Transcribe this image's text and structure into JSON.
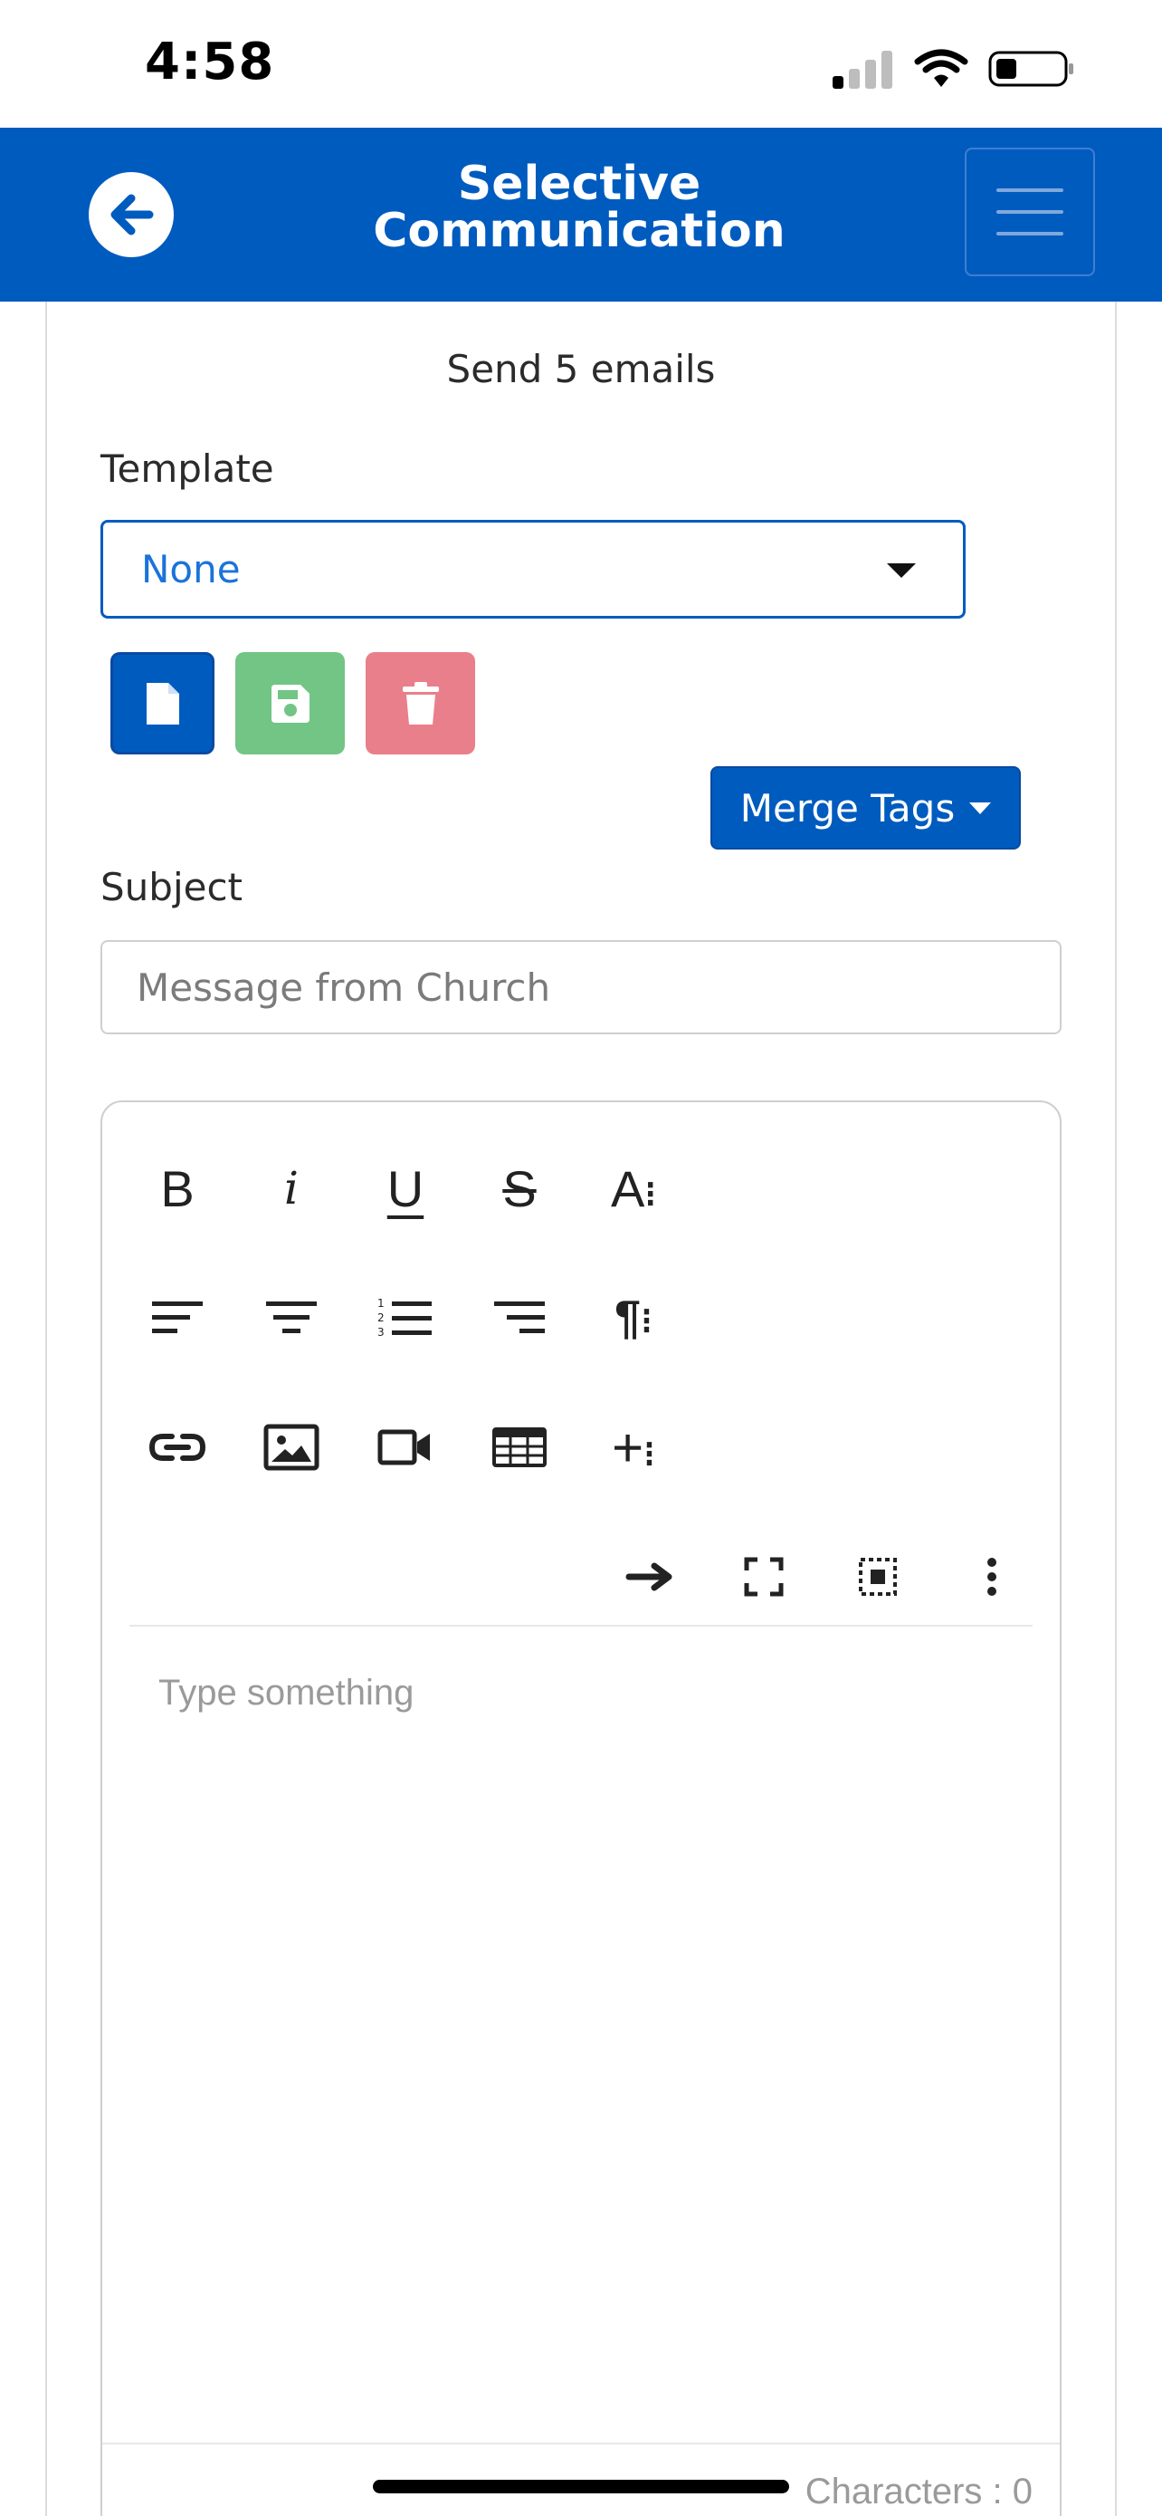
{
  "status_bar": {
    "time": "4:58"
  },
  "header": {
    "title_line1": "Selective",
    "title_line2": "Communication"
  },
  "form": {
    "send_info": "Send 5 emails",
    "template_label": "Template",
    "template_value": "None",
    "merge_tags_label": "Merge Tags",
    "subject_label": "Subject",
    "subject_placeholder": "Message from Church"
  },
  "editor": {
    "placeholder": "Type something",
    "char_count": "Characters : 0",
    "toolbar_icons": [
      "bold-icon",
      "italic-icon",
      "underline-icon",
      "strikethrough-icon",
      "font-options-icon",
      "align-left-icon",
      "align-center-icon",
      "ordered-list-icon",
      "align-right-icon",
      "paragraph-format-icon",
      "link-icon",
      "image-icon",
      "video-icon",
      "table-icon",
      "insert-more-icon",
      "arrow-right-icon",
      "fullscreen-icon",
      "select-all-icon",
      "more-options-icon"
    ]
  },
  "colors": {
    "brand": "#005bbf",
    "success": "#72c585",
    "danger": "#e97f8a"
  }
}
